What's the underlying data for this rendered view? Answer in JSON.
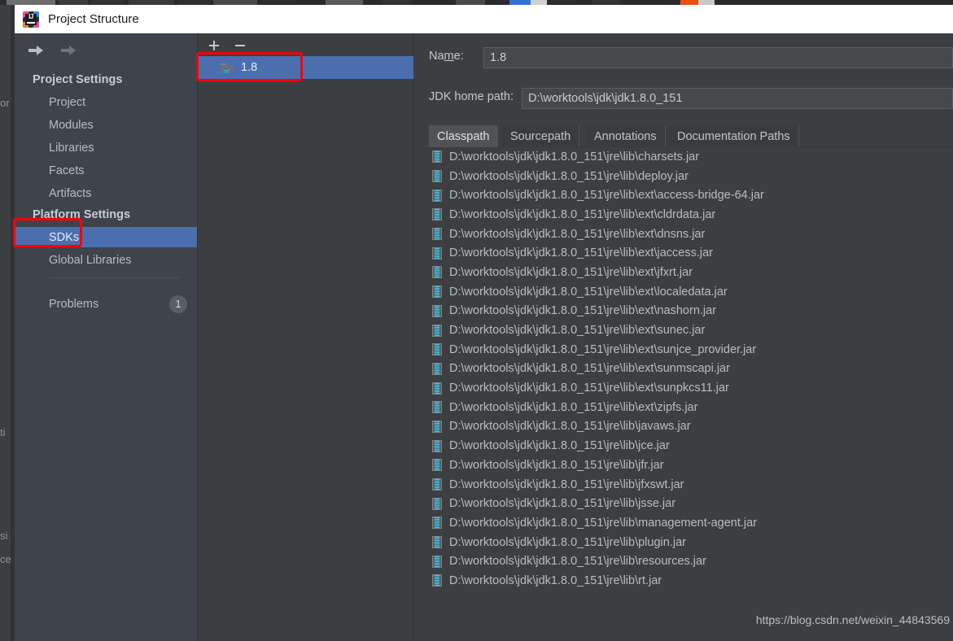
{
  "window": {
    "title": "Project Structure",
    "app_icon": "intellij-idea-logo",
    "icon_text": "IJ"
  },
  "nav_buttons": {
    "back": "back-arrow",
    "forward": "forward-arrow"
  },
  "sidebar": {
    "sections": [
      {
        "heading": "Project Settings",
        "items": [
          {
            "label": "Project",
            "selected": false
          },
          {
            "label": "Modules",
            "selected": false
          },
          {
            "label": "Libraries",
            "selected": false
          },
          {
            "label": "Facets",
            "selected": false
          },
          {
            "label": "Artifacts",
            "selected": false
          }
        ]
      },
      {
        "heading": "Platform Settings",
        "items": [
          {
            "label": "SDKs",
            "selected": true
          },
          {
            "label": "Global Libraries",
            "selected": false
          }
        ]
      }
    ],
    "problems": {
      "label": "Problems",
      "count": "1"
    }
  },
  "sdk_list": {
    "toolbar": {
      "add_label": "+",
      "remove_label": "−"
    },
    "items": [
      {
        "label": "1.8",
        "icon": "jdk-folder-icon",
        "selected": true
      }
    ]
  },
  "detail": {
    "name_label_pre": "Na",
    "name_label_mnemonic": "m",
    "name_label_post": "e:",
    "name_value": "1.8",
    "jdk_home_label": "JDK home path:",
    "jdk_home_value": "D:\\worktools\\jdk\\jdk1.8.0_151",
    "tabs": [
      {
        "label": "Classpath",
        "active": true
      },
      {
        "label": "Sourcepath",
        "active": false
      },
      {
        "label": "Annotations",
        "active": false
      },
      {
        "label": "Documentation Paths",
        "active": false
      }
    ],
    "classpath_entries": [
      "D:\\worktools\\jdk\\jdk1.8.0_151\\jre\\lib\\charsets.jar",
      "D:\\worktools\\jdk\\jdk1.8.0_151\\jre\\lib\\deploy.jar",
      "D:\\worktools\\jdk\\jdk1.8.0_151\\jre\\lib\\ext\\access-bridge-64.jar",
      "D:\\worktools\\jdk\\jdk1.8.0_151\\jre\\lib\\ext\\cldrdata.jar",
      "D:\\worktools\\jdk\\jdk1.8.0_151\\jre\\lib\\ext\\dnsns.jar",
      "D:\\worktools\\jdk\\jdk1.8.0_151\\jre\\lib\\ext\\jaccess.jar",
      "D:\\worktools\\jdk\\jdk1.8.0_151\\jre\\lib\\ext\\jfxrt.jar",
      "D:\\worktools\\jdk\\jdk1.8.0_151\\jre\\lib\\ext\\localedata.jar",
      "D:\\worktools\\jdk\\jdk1.8.0_151\\jre\\lib\\ext\\nashorn.jar",
      "D:\\worktools\\jdk\\jdk1.8.0_151\\jre\\lib\\ext\\sunec.jar",
      "D:\\worktools\\jdk\\jdk1.8.0_151\\jre\\lib\\ext\\sunjce_provider.jar",
      "D:\\worktools\\jdk\\jdk1.8.0_151\\jre\\lib\\ext\\sunmscapi.jar",
      "D:\\worktools\\jdk\\jdk1.8.0_151\\jre\\lib\\ext\\sunpkcs11.jar",
      "D:\\worktools\\jdk\\jdk1.8.0_151\\jre\\lib\\ext\\zipfs.jar",
      "D:\\worktools\\jdk\\jdk1.8.0_151\\jre\\lib\\javaws.jar",
      "D:\\worktools\\jdk\\jdk1.8.0_151\\jre\\lib\\jce.jar",
      "D:\\worktools\\jdk\\jdk1.8.0_151\\jre\\lib\\jfr.jar",
      "D:\\worktools\\jdk\\jdk1.8.0_151\\jre\\lib\\jfxswt.jar",
      "D:\\worktools\\jdk\\jdk1.8.0_151\\jre\\lib\\jsse.jar",
      "D:\\worktools\\jdk\\jdk1.8.0_151\\jre\\lib\\management-agent.jar",
      "D:\\worktools\\jdk\\jdk1.8.0_151\\jre\\lib\\plugin.jar",
      "D:\\worktools\\jdk\\jdk1.8.0_151\\jre\\lib\\resources.jar",
      "D:\\worktools\\jdk\\jdk1.8.0_151\\jre\\lib\\rt.jar"
    ]
  },
  "watermark": "https://blog.csdn.net/weixin_44843569",
  "background_fragments": [
    "or",
    "ti",
    "si",
    "ce"
  ],
  "colors": {
    "accent_selection": "#4b6eaf",
    "annotation_red": "#fb0007",
    "sidebar_bg": "#3f434b",
    "panel_bg": "#3c3f41",
    "titlebar_bg": "#ffffff",
    "jar_icon": "#57c8e8"
  }
}
